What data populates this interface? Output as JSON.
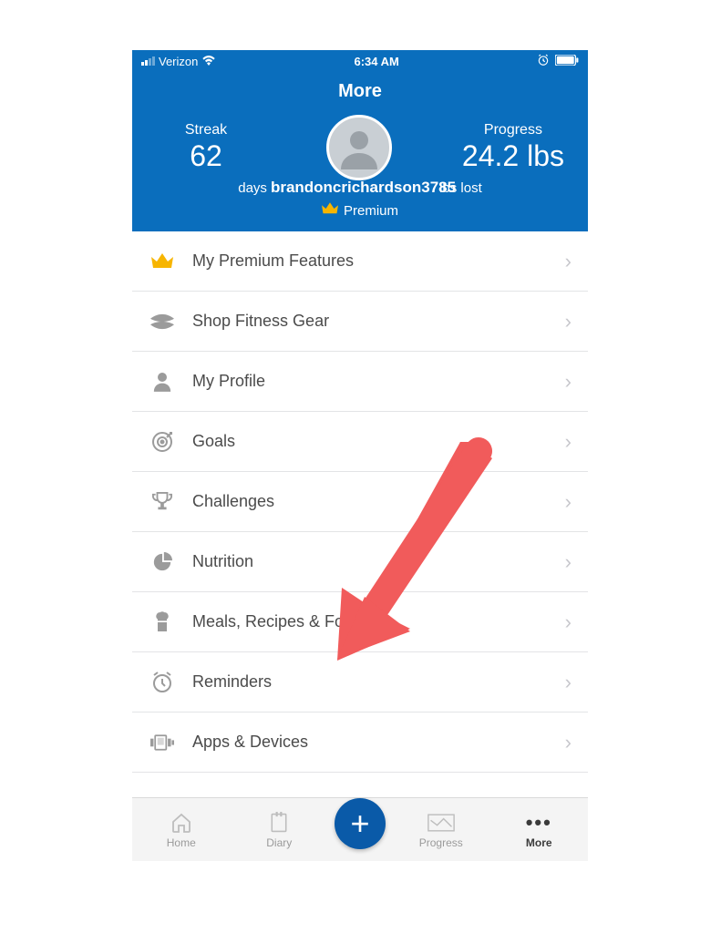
{
  "status": {
    "carrier": "Verizon",
    "time": "6:34 AM"
  },
  "header": {
    "title": "More",
    "streak_label": "Streak",
    "streak_value": "62",
    "streak_unit": "days",
    "progress_label": "Progress",
    "progress_value": "24.2 lbs",
    "progress_unit": "lbs lost",
    "username": "brandoncrichardson3785",
    "premium_label": "Premium"
  },
  "menu": [
    {
      "icon": "crown",
      "label": "My Premium Features",
      "gold": true,
      "name": "menu-item-premium-features"
    },
    {
      "icon": "ua",
      "label": "Shop Fitness Gear",
      "name": "menu-item-shop-gear"
    },
    {
      "icon": "person",
      "label": "My Profile",
      "name": "menu-item-my-profile"
    },
    {
      "icon": "target",
      "label": "Goals",
      "name": "menu-item-goals"
    },
    {
      "icon": "trophy",
      "label": "Challenges",
      "name": "menu-item-challenges"
    },
    {
      "icon": "pie",
      "label": "Nutrition",
      "name": "menu-item-nutrition"
    },
    {
      "icon": "chef",
      "label": "Meals, Recipes & Foods",
      "name": "menu-item-meals"
    },
    {
      "icon": "alarm",
      "label": "Reminders",
      "name": "menu-item-reminders"
    },
    {
      "icon": "device",
      "label": "Apps & Devices",
      "name": "menu-item-apps-devices"
    }
  ],
  "tabs": {
    "home": "Home",
    "diary": "Diary",
    "progress": "Progress",
    "more": "More"
  },
  "colors": {
    "brand_blue": "#0a6ebd",
    "fab_blue": "#0a5aa8",
    "arrow": "#f15b5b",
    "gold": "#f7b500",
    "grey_icon": "#9b9b9b"
  }
}
